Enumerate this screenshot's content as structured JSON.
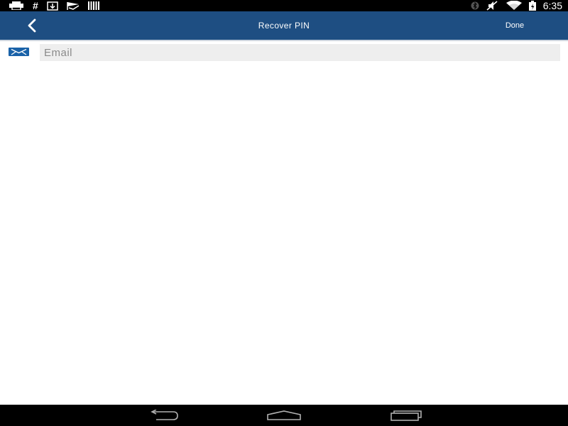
{
  "status_bar": {
    "time": "6:35",
    "left_icons": [
      "printer-icon",
      "hash-icon",
      "download-icon",
      "checkbox-flag-icon",
      "barcode-icon"
    ],
    "right_icons": [
      "bluetooth-icon",
      "mute-icon",
      "wifi-icon",
      "battery-charging-icon"
    ],
    "hash_glyph": "#"
  },
  "action_bar": {
    "title": "Recover PIN",
    "done_label": "Done",
    "color": "#1e4e82"
  },
  "form": {
    "email_placeholder": "Email",
    "email_value": "",
    "email_icon": "envelope-icon",
    "icon_color": "#1a62a8"
  },
  "nav_bar": {
    "buttons": [
      "back-nav-icon",
      "home-nav-icon",
      "recents-nav-icon"
    ]
  }
}
